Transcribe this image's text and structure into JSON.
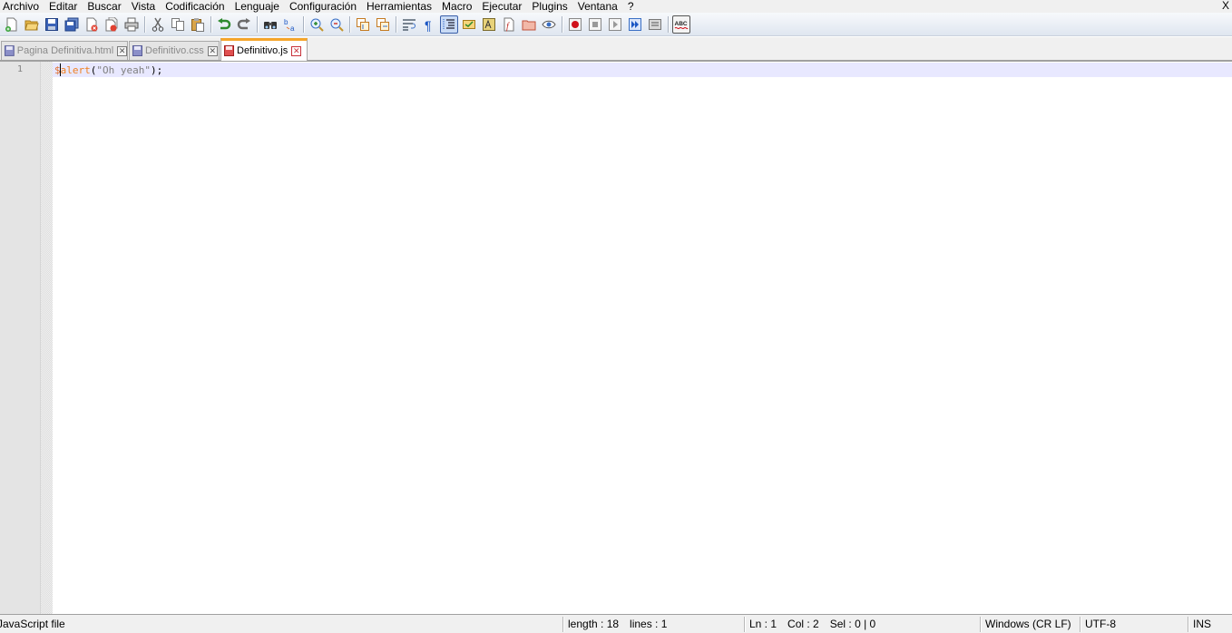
{
  "menu": {
    "items": [
      "Archivo",
      "Editar",
      "Buscar",
      "Vista",
      "Codificación",
      "Lenguaje",
      "Configuración",
      "Herramientas",
      "Macro",
      "Ejecutar",
      "Plugins",
      "Ventana",
      "?"
    ],
    "close_label": "X"
  },
  "toolbar": {
    "buttons": [
      "new-file-icon",
      "open-file-icon",
      "save-icon",
      "save-all-icon",
      "close-icon",
      "close-all-icon",
      "print-icon",
      "cut-icon",
      "copy-icon",
      "paste-icon",
      "undo-icon",
      "redo-icon",
      "find-icon",
      "replace-icon",
      "zoom-in-icon",
      "zoom-out-icon",
      "sync-vertical-icon",
      "sync-horizontal-icon",
      "word-wrap-icon",
      "show-all-chars-icon",
      "indent-guide-icon",
      "user-language-icon",
      "document-map-icon",
      "function-list-icon",
      "folder-workspace-icon",
      "monitor-icon",
      "record-macro-icon",
      "stop-recording-icon",
      "playback-macro-icon",
      "run-macro-multiple-icon",
      "save-macro-icon",
      "spell-check-icon"
    ],
    "spell_check_label": "ABC"
  },
  "tabs": [
    {
      "label": "Pagina Definitiva.html",
      "icon": "saved-doc-icon",
      "active": false
    },
    {
      "label": "Definitivo.css",
      "icon": "saved-doc-icon",
      "active": false
    },
    {
      "label": "Definitivo.js",
      "icon": "unsaved-doc-icon",
      "active": true
    }
  ],
  "editor": {
    "line_number": "1",
    "code": {
      "var": "$",
      "fn": "alert",
      "open": "(",
      "string": "\"Oh yeah\"",
      "close": ");"
    }
  },
  "status": {
    "file_type": "JavaScript file",
    "length": "length : 18",
    "lines": "lines : 1",
    "ln": "Ln : 1",
    "col": "Col : 2",
    "sel": "Sel : 0 | 0",
    "eol": "Windows (CR LF)",
    "encoding": "UTF-8",
    "mode": "INS"
  },
  "colors": {
    "active_tab_accent": "#f5a52a",
    "caret_line": "#e8e8ff",
    "keyword_orange": "#f08020"
  }
}
